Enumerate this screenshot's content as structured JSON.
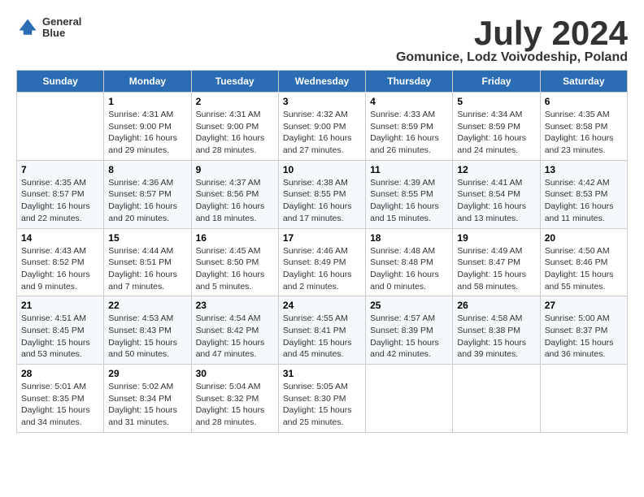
{
  "header": {
    "logo_line1": "General",
    "logo_line2": "Blue",
    "title": "July 2024",
    "subtitle": "Gomunice, Lodz Voivodeship, Poland"
  },
  "weekdays": [
    "Sunday",
    "Monday",
    "Tuesday",
    "Wednesday",
    "Thursday",
    "Friday",
    "Saturday"
  ],
  "weeks": [
    [
      {
        "day": "",
        "content": ""
      },
      {
        "day": "1",
        "content": "Sunrise: 4:31 AM\nSunset: 9:00 PM\nDaylight: 16 hours\nand 29 minutes."
      },
      {
        "day": "2",
        "content": "Sunrise: 4:31 AM\nSunset: 9:00 PM\nDaylight: 16 hours\nand 28 minutes."
      },
      {
        "day": "3",
        "content": "Sunrise: 4:32 AM\nSunset: 9:00 PM\nDaylight: 16 hours\nand 27 minutes."
      },
      {
        "day": "4",
        "content": "Sunrise: 4:33 AM\nSunset: 8:59 PM\nDaylight: 16 hours\nand 26 minutes."
      },
      {
        "day": "5",
        "content": "Sunrise: 4:34 AM\nSunset: 8:59 PM\nDaylight: 16 hours\nand 24 minutes."
      },
      {
        "day": "6",
        "content": "Sunrise: 4:35 AM\nSunset: 8:58 PM\nDaylight: 16 hours\nand 23 minutes."
      }
    ],
    [
      {
        "day": "7",
        "content": "Sunrise: 4:35 AM\nSunset: 8:57 PM\nDaylight: 16 hours\nand 22 minutes."
      },
      {
        "day": "8",
        "content": "Sunrise: 4:36 AM\nSunset: 8:57 PM\nDaylight: 16 hours\nand 20 minutes."
      },
      {
        "day": "9",
        "content": "Sunrise: 4:37 AM\nSunset: 8:56 PM\nDaylight: 16 hours\nand 18 minutes."
      },
      {
        "day": "10",
        "content": "Sunrise: 4:38 AM\nSunset: 8:55 PM\nDaylight: 16 hours\nand 17 minutes."
      },
      {
        "day": "11",
        "content": "Sunrise: 4:39 AM\nSunset: 8:55 PM\nDaylight: 16 hours\nand 15 minutes."
      },
      {
        "day": "12",
        "content": "Sunrise: 4:41 AM\nSunset: 8:54 PM\nDaylight: 16 hours\nand 13 minutes."
      },
      {
        "day": "13",
        "content": "Sunrise: 4:42 AM\nSunset: 8:53 PM\nDaylight: 16 hours\nand 11 minutes."
      }
    ],
    [
      {
        "day": "14",
        "content": "Sunrise: 4:43 AM\nSunset: 8:52 PM\nDaylight: 16 hours\nand 9 minutes."
      },
      {
        "day": "15",
        "content": "Sunrise: 4:44 AM\nSunset: 8:51 PM\nDaylight: 16 hours\nand 7 minutes."
      },
      {
        "day": "16",
        "content": "Sunrise: 4:45 AM\nSunset: 8:50 PM\nDaylight: 16 hours\nand 5 minutes."
      },
      {
        "day": "17",
        "content": "Sunrise: 4:46 AM\nSunset: 8:49 PM\nDaylight: 16 hours\nand 2 minutes."
      },
      {
        "day": "18",
        "content": "Sunrise: 4:48 AM\nSunset: 8:48 PM\nDaylight: 16 hours\nand 0 minutes."
      },
      {
        "day": "19",
        "content": "Sunrise: 4:49 AM\nSunset: 8:47 PM\nDaylight: 15 hours\nand 58 minutes."
      },
      {
        "day": "20",
        "content": "Sunrise: 4:50 AM\nSunset: 8:46 PM\nDaylight: 15 hours\nand 55 minutes."
      }
    ],
    [
      {
        "day": "21",
        "content": "Sunrise: 4:51 AM\nSunset: 8:45 PM\nDaylight: 15 hours\nand 53 minutes."
      },
      {
        "day": "22",
        "content": "Sunrise: 4:53 AM\nSunset: 8:43 PM\nDaylight: 15 hours\nand 50 minutes."
      },
      {
        "day": "23",
        "content": "Sunrise: 4:54 AM\nSunset: 8:42 PM\nDaylight: 15 hours\nand 47 minutes."
      },
      {
        "day": "24",
        "content": "Sunrise: 4:55 AM\nSunset: 8:41 PM\nDaylight: 15 hours\nand 45 minutes."
      },
      {
        "day": "25",
        "content": "Sunrise: 4:57 AM\nSunset: 8:39 PM\nDaylight: 15 hours\nand 42 minutes."
      },
      {
        "day": "26",
        "content": "Sunrise: 4:58 AM\nSunset: 8:38 PM\nDaylight: 15 hours\nand 39 minutes."
      },
      {
        "day": "27",
        "content": "Sunrise: 5:00 AM\nSunset: 8:37 PM\nDaylight: 15 hours\nand 36 minutes."
      }
    ],
    [
      {
        "day": "28",
        "content": "Sunrise: 5:01 AM\nSunset: 8:35 PM\nDaylight: 15 hours\nand 34 minutes."
      },
      {
        "day": "29",
        "content": "Sunrise: 5:02 AM\nSunset: 8:34 PM\nDaylight: 15 hours\nand 31 minutes."
      },
      {
        "day": "30",
        "content": "Sunrise: 5:04 AM\nSunset: 8:32 PM\nDaylight: 15 hours\nand 28 minutes."
      },
      {
        "day": "31",
        "content": "Sunrise: 5:05 AM\nSunset: 8:30 PM\nDaylight: 15 hours\nand 25 minutes."
      },
      {
        "day": "",
        "content": ""
      },
      {
        "day": "",
        "content": ""
      },
      {
        "day": "",
        "content": ""
      }
    ]
  ]
}
